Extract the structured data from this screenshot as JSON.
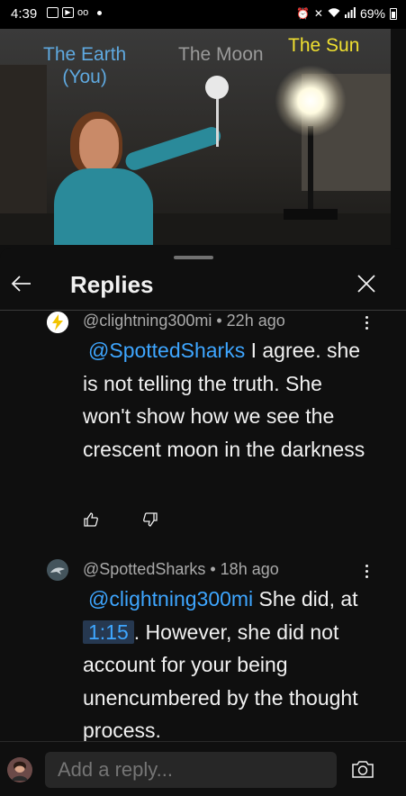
{
  "status_bar": {
    "time": "4:39",
    "battery": "69%"
  },
  "video": {
    "label_earth_line1": "The Earth",
    "label_earth_line2": "(You)",
    "label_moon": "The Moon",
    "label_sun": "The Sun"
  },
  "sheet": {
    "title": "Replies"
  },
  "comments": [
    {
      "author": "@clightning300mi",
      "age": "22h ago",
      "mention": "@SpottedSharks",
      "text_after_mention": " I agree. she is not telling the truth. She won't show how we see the crescent moon in the darkness"
    },
    {
      "author": "@SpottedSharks",
      "age": "18h ago",
      "mention": "@clightning300mi",
      "text_part1": " She did, at ",
      "timestamp": "1:15",
      "text_part2": ". However, she did not account for your being unencumbered by the thought process."
    }
  ],
  "reply_box": {
    "placeholder": "Add a reply..."
  },
  "colors": {
    "background": "#0f0f0f",
    "link": "#3ea6ff",
    "meta": "#aaaaaa"
  }
}
